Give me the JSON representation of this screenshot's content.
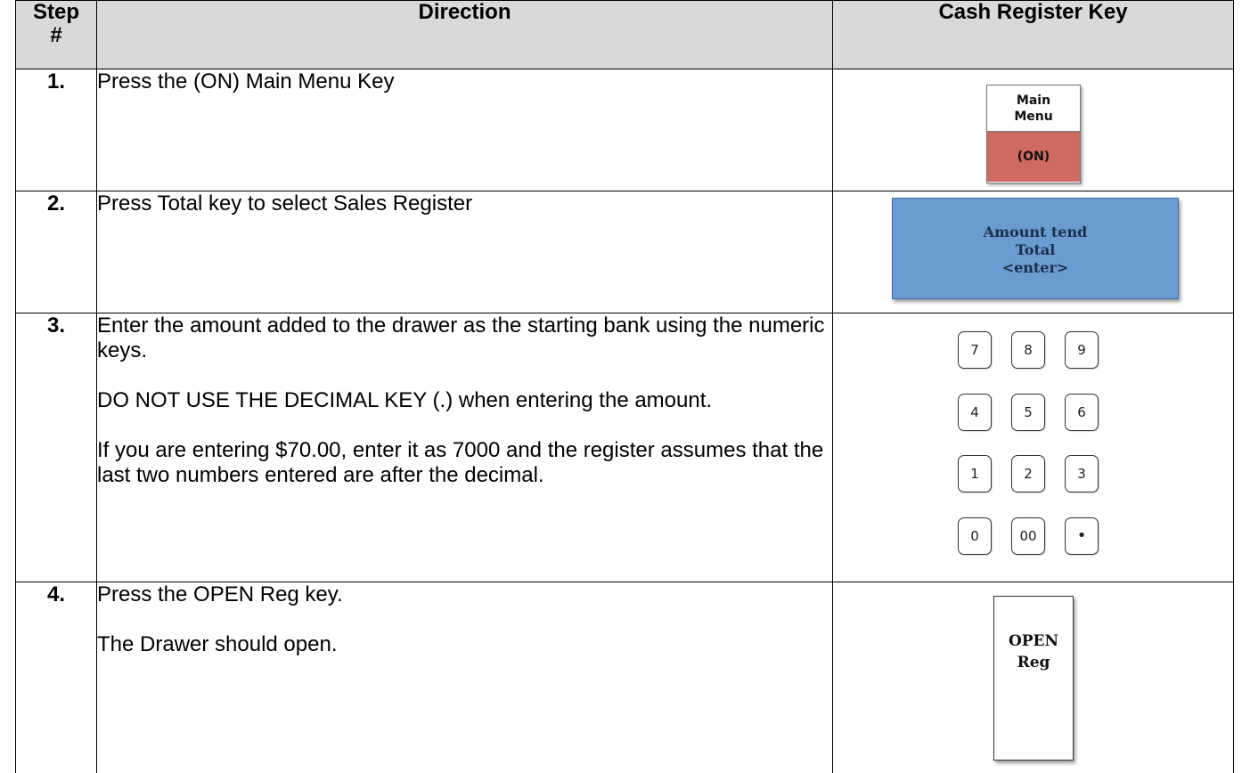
{
  "headers": {
    "step": "Step #",
    "direction": "Direction",
    "key": "Cash Register Key"
  },
  "rows": [
    {
      "step": "1.",
      "direction": [
        "Press the (ON) Main Menu Key"
      ],
      "key": {
        "type": "main-menu",
        "top_lines": [
          "Main",
          "Menu"
        ],
        "bottom": "(ON)",
        "bottom_color": "#cf6a62"
      }
    },
    {
      "step": "2.",
      "direction": [
        "Press Total key to select Sales Register"
      ],
      "key": {
        "type": "total",
        "lines": [
          "Amount tend",
          "Total",
          "<enter>"
        ],
        "color": "#6a9bd1"
      }
    },
    {
      "step": "3.",
      "direction": [
        "Enter the amount added to the drawer as the starting bank using the numeric keys.",
        "DO NOT USE THE DECIMAL KEY (.) when entering the amount.",
        "If you are entering $70.00, enter it as 7000 and the register assumes that the last two numbers entered are after the decimal."
      ],
      "key": {
        "type": "numeric-keypad",
        "keys": [
          [
            "7",
            "8",
            "9"
          ],
          [
            "4",
            "5",
            "6"
          ],
          [
            "1",
            "2",
            "3"
          ],
          [
            "0",
            "00",
            "•"
          ]
        ]
      }
    },
    {
      "step": "4.",
      "direction": [
        "Press the OPEN Reg key.",
        "The Drawer should open."
      ],
      "key": {
        "type": "open-reg",
        "lines": [
          "OPEN",
          "Reg"
        ]
      }
    }
  ]
}
